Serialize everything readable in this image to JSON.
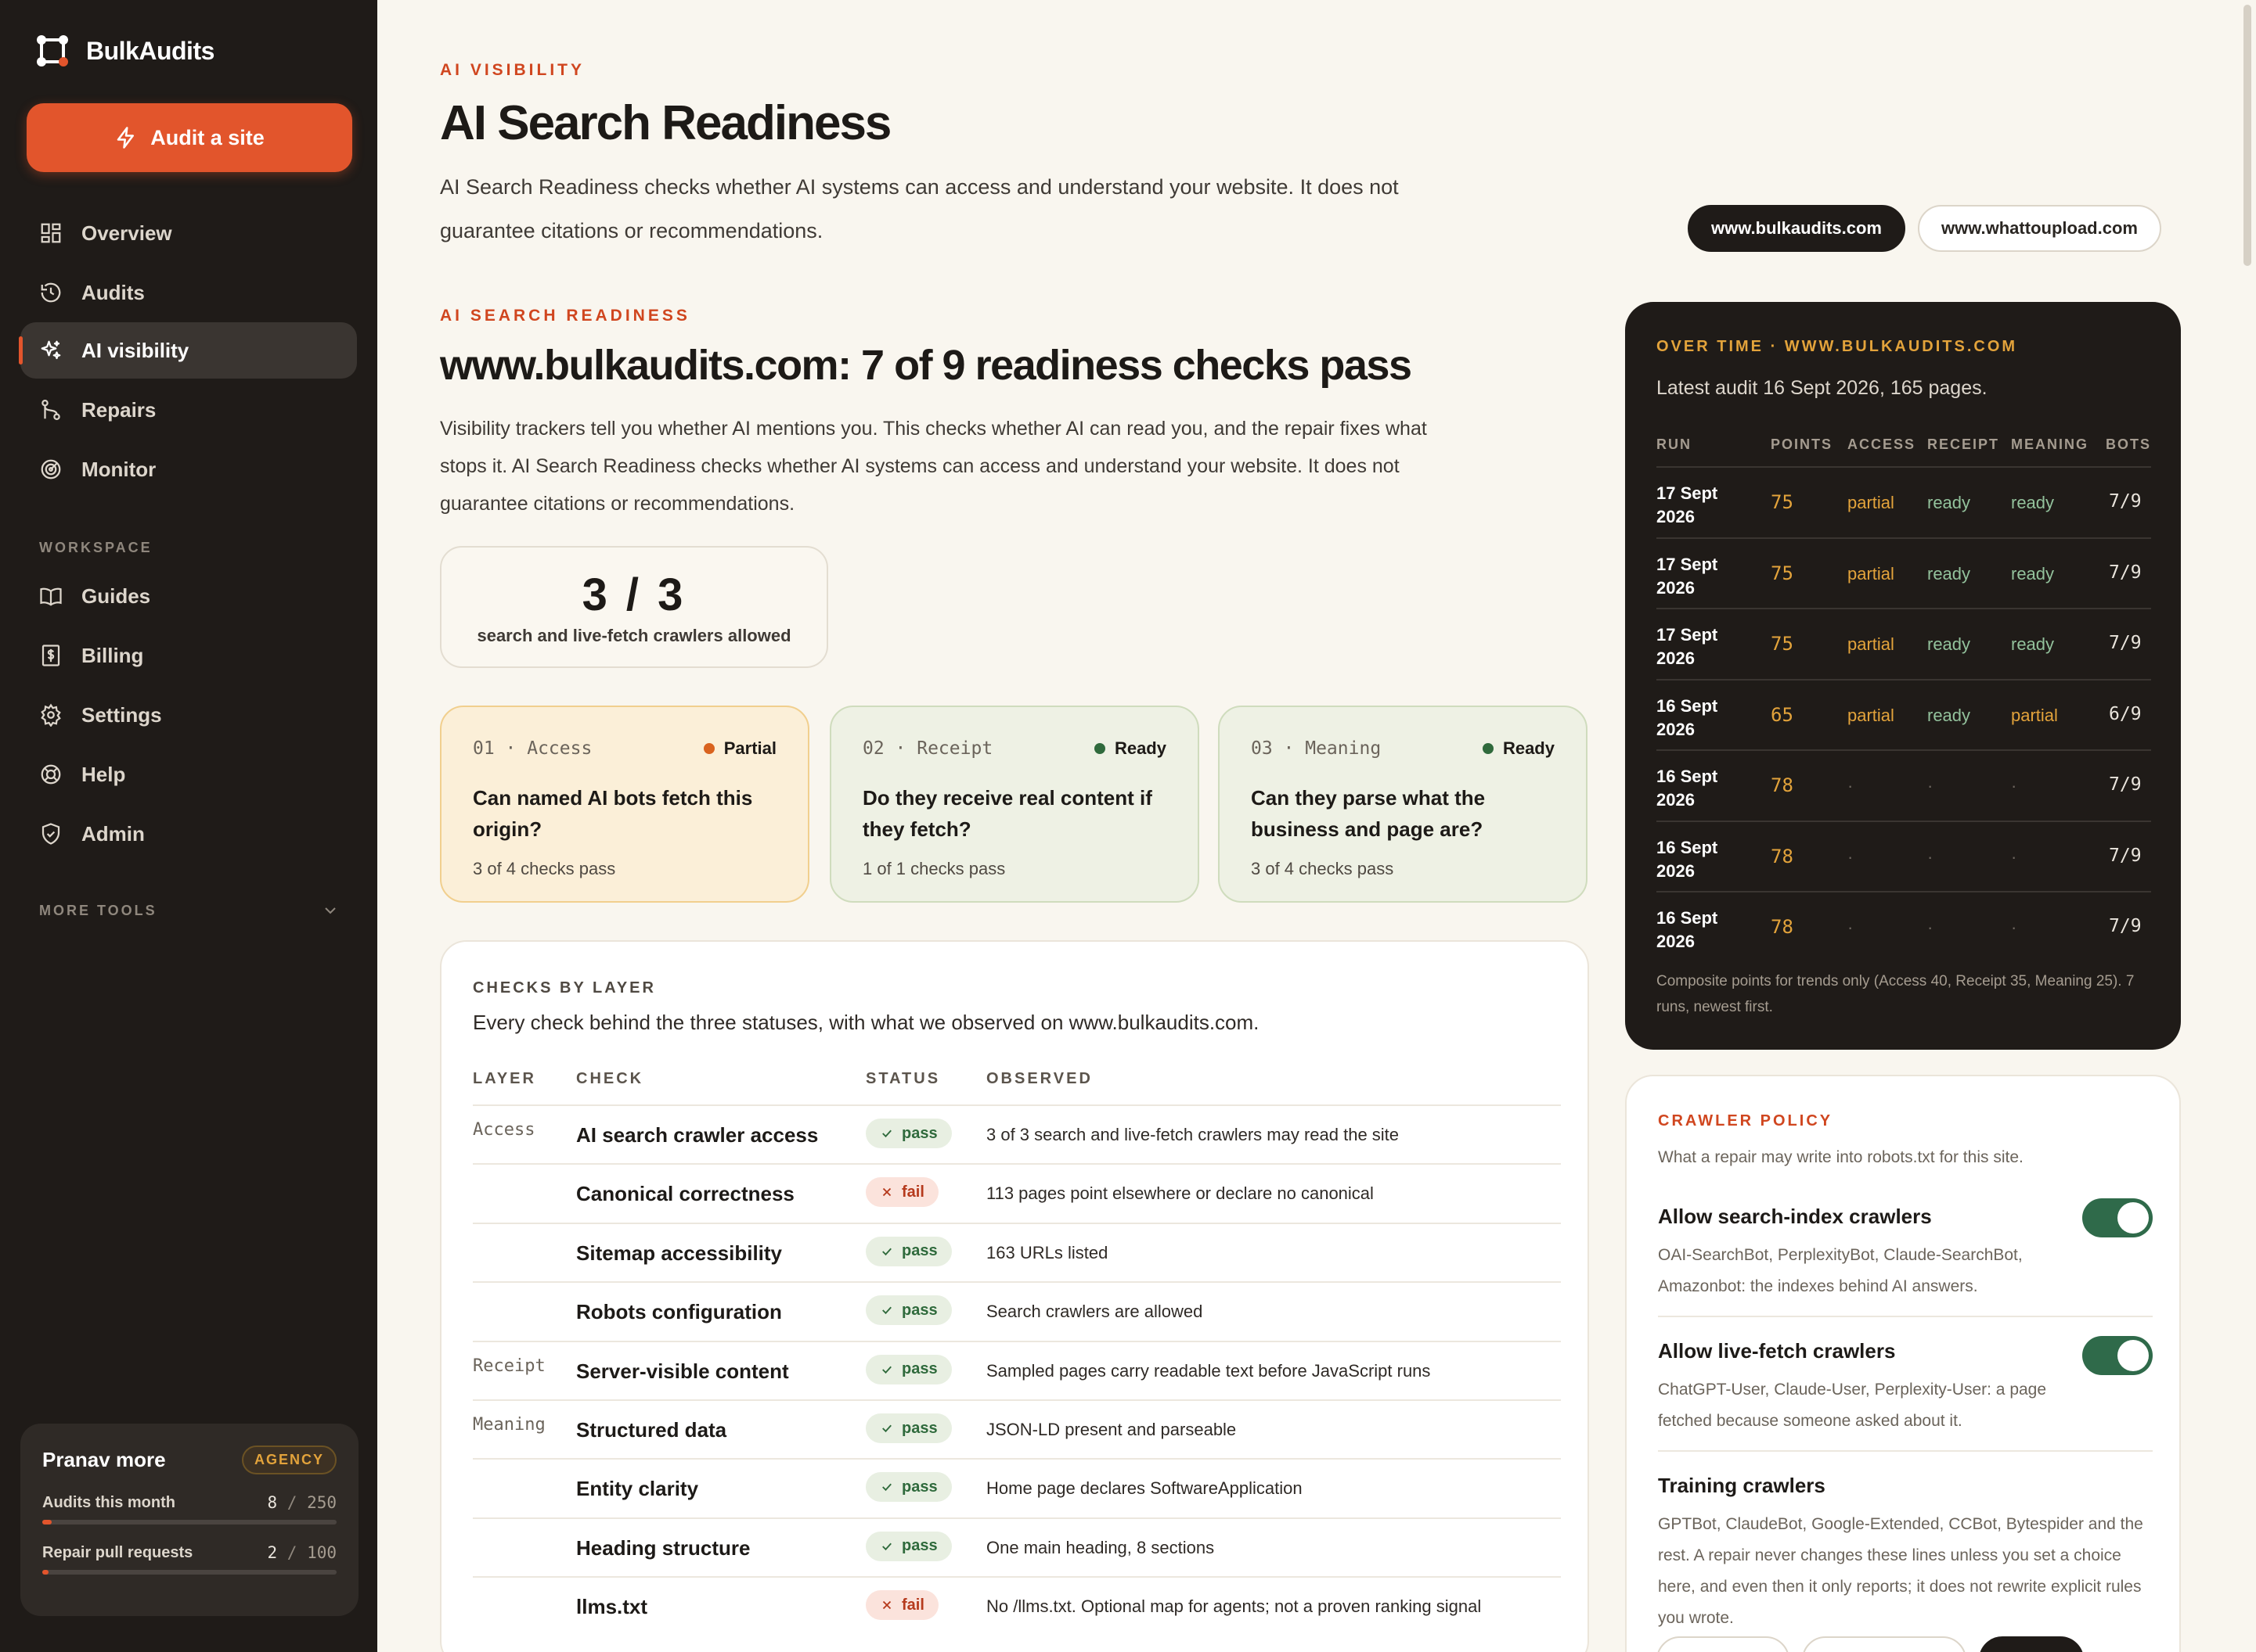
{
  "brand": {
    "name": "BulkAudits"
  },
  "sidebar": {
    "cta_label": "Audit a site",
    "nav": [
      {
        "label": "Overview",
        "icon": "grid-icon"
      },
      {
        "label": "Audits",
        "icon": "history-icon"
      },
      {
        "label": "AI visibility",
        "icon": "sparkles-icon",
        "active": true
      },
      {
        "label": "Repairs",
        "icon": "git-branch-icon"
      },
      {
        "label": "Monitor",
        "icon": "radar-icon"
      }
    ],
    "workspace_label": "WORKSPACE",
    "workspace": [
      {
        "label": "Guides",
        "icon": "book-icon"
      },
      {
        "label": "Billing",
        "icon": "receipt-icon"
      },
      {
        "label": "Settings",
        "icon": "gear-icon"
      },
      {
        "label": "Help",
        "icon": "lifebuoy-icon"
      },
      {
        "label": "Admin",
        "icon": "shield-icon"
      }
    ],
    "more_tools_label": "MORE TOOLS",
    "plan": {
      "user": "Pranav more",
      "badge": "AGENCY",
      "usage": [
        {
          "label": "Audits this month",
          "used": "8",
          "limit": "250",
          "fraction": 0.032
        },
        {
          "label": "Repair pull requests",
          "used": "2",
          "limit": "100",
          "fraction": 0.02
        }
      ]
    }
  },
  "header": {
    "eyebrow": "AI VISIBILITY",
    "title": "AI Search Readiness",
    "lead_1": "AI Search Readiness checks whether AI systems can access and understand your website. It does not",
    "lead_2": "guarantee citations or recommendations.",
    "domains": [
      "www.bulkaudits.com",
      "www.whattoupload.com"
    ],
    "active_domain": "www.bulkaudits.com"
  },
  "readiness": {
    "eyebrow": "AI SEARCH READINESS",
    "headline": "www.bulkaudits.com: 7 of 9 readiness checks pass",
    "lead_1": "Visibility trackers tell you whether AI mentions you. This checks whether AI can read you, and the repair fixes what",
    "lead_2": "stops it. AI Search Readiness checks whether AI systems can access and understand your website. It does not",
    "lead_3": "guarantee citations or recommendations.",
    "stat_value": "3 / 3",
    "stat_label": "search and live-fetch crawlers allowed"
  },
  "layers": [
    {
      "tag": "01 · Access",
      "status": "Partial",
      "question": "Can named AI bots fetch this origin?",
      "summary": "3 of 4 checks pass",
      "color": "#d9631f"
    },
    {
      "tag": "02 · Receipt",
      "status": "Ready",
      "question": "Do they receive real content if they fetch?",
      "summary": "1 of 1 checks pass",
      "color": "#2f6a3c"
    },
    {
      "tag": "03 · Meaning",
      "status": "Ready",
      "question": "Can they parse what the business and page are?",
      "summary": "3 of 4 checks pass",
      "color": "#2f6a3c"
    }
  ],
  "checks": {
    "eyebrow": "CHECKS BY LAYER",
    "subtitle": "Every check behind the three statuses, with what we observed on www.bulkaudits.com.",
    "headers": [
      "LAYER",
      "CHECK",
      "STATUS",
      "OBSERVED"
    ],
    "rows": [
      {
        "layer": "Access",
        "check": "AI search crawler access",
        "status": "pass",
        "observed": "3 of 3 search and live-fetch crawlers may read the site"
      },
      {
        "layer": "",
        "check": "Canonical correctness",
        "status": "fail",
        "observed": "113 pages point elsewhere or declare no canonical"
      },
      {
        "layer": "",
        "check": "Sitemap accessibility",
        "status": "pass",
        "observed": "163 URLs listed"
      },
      {
        "layer": "",
        "check": "Robots configuration",
        "status": "pass",
        "observed": "Search crawlers are allowed"
      },
      {
        "layer": "Receipt",
        "check": "Server-visible content",
        "status": "pass",
        "observed": "Sampled pages carry readable text before JavaScript runs"
      },
      {
        "layer": "Meaning",
        "check": "Structured data",
        "status": "pass",
        "observed": "JSON-LD present and parseable"
      },
      {
        "layer": "",
        "check": "Entity clarity",
        "status": "pass",
        "observed": "Home page declares SoftwareApplication"
      },
      {
        "layer": "",
        "check": "Heading structure",
        "status": "pass",
        "observed": "One main heading, 8 sections"
      },
      {
        "layer": "",
        "check": "llms.txt",
        "status": "fail",
        "observed": "No /llms.txt. Optional map for agents; not a proven ranking signal"
      }
    ]
  },
  "over_time": {
    "eyebrow": "OVER TIME · WWW.BULKAUDITS.COM",
    "subtitle": "Latest audit 16 Sept 2026, 165 pages.",
    "headers": [
      "RUN",
      "POINTS",
      "ACCESS",
      "RECEIPT",
      "MEANING",
      "BOTS"
    ],
    "rows": [
      {
        "run_day": "17 Sept",
        "run_year": "2026",
        "points": "75",
        "access": "partial",
        "receipt": "ready",
        "meaning": "ready",
        "bots": "7/9"
      },
      {
        "run_day": "17 Sept",
        "run_year": "2026",
        "points": "75",
        "access": "partial",
        "receipt": "ready",
        "meaning": "ready",
        "bots": "7/9"
      },
      {
        "run_day": "17 Sept",
        "run_year": "2026",
        "points": "75",
        "access": "partial",
        "receipt": "ready",
        "meaning": "ready",
        "bots": "7/9"
      },
      {
        "run_day": "16 Sept",
        "run_year": "2026",
        "points": "65",
        "access": "partial",
        "receipt": "ready",
        "meaning": "partial",
        "bots": "6/9"
      },
      {
        "run_day": "16 Sept",
        "run_year": "2026",
        "points": "78",
        "access": "·",
        "receipt": "·",
        "meaning": "·",
        "bots": "7/9"
      },
      {
        "run_day": "16 Sept",
        "run_year": "2026",
        "points": "78",
        "access": "·",
        "receipt": "·",
        "meaning": "·",
        "bots": "7/9"
      },
      {
        "run_day": "16 Sept",
        "run_year": "2026",
        "points": "78",
        "access": "·",
        "receipt": "·",
        "meaning": "·",
        "bots": "7/9"
      }
    ],
    "footnote": "Composite points for trends only (Access 40, Receipt 35, Meaning 25). 7 runs, newest first."
  },
  "crawler_policy": {
    "eyebrow": "CRAWLER POLICY",
    "subtitle": "What a repair may write into robots.txt for this site.",
    "items": [
      {
        "title": "Allow search-index crawlers",
        "desc": "OAI-SearchBot, PerplexityBot, Claude-SearchBot, Amazonbot: the indexes behind AI answers.",
        "enabled": true
      },
      {
        "title": "Allow live-fetch crawlers",
        "desc": "ChatGPT-User, Claude-User, Perplexity-User: a page fetched because someone asked about it.",
        "enabled": true
      },
      {
        "title": "Training crawlers",
        "desc": "GPTBot, ClaudeBot, Google-Extended, CCBot, Bytespider and the rest. A repair never changes these lines unless you set a choice here, and even then it only reports; it does not rewrite explicit rules you wrote."
      }
    ]
  },
  "colors": {
    "accent": "#e2552c",
    "sidebar_bg": "#1f1b18",
    "pass": "#2f6a3c",
    "fail": "#b63a1d",
    "partial": "#e3a33b"
  }
}
